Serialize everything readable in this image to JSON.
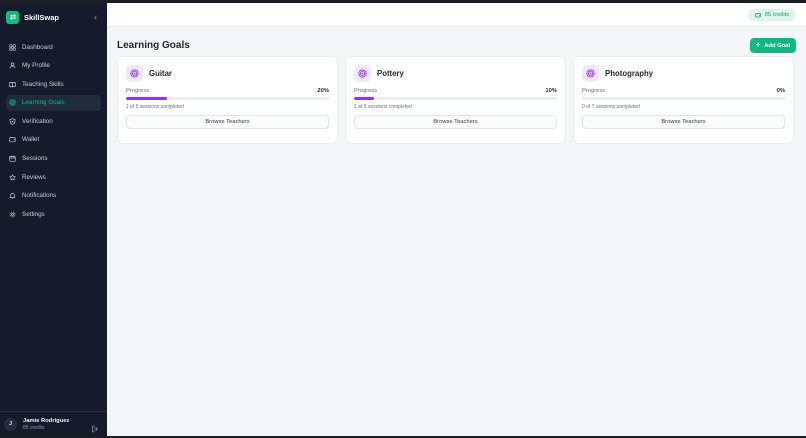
{
  "brand": {
    "name": "SkillSwap"
  },
  "sidebar": {
    "items": [
      {
        "label": "Dashboard",
        "icon": "grid-icon",
        "active": false
      },
      {
        "label": "My Profile",
        "icon": "user-icon",
        "active": false
      },
      {
        "label": "Teaching Skills",
        "icon": "book-icon",
        "active": false
      },
      {
        "label": "Learning Goals",
        "icon": "target-icon",
        "active": true
      },
      {
        "label": "Verification",
        "icon": "shield-icon",
        "active": false
      },
      {
        "label": "Wallet",
        "icon": "wallet-icon",
        "active": false
      },
      {
        "label": "Sessions",
        "icon": "calendar-icon",
        "active": false
      },
      {
        "label": "Reviews",
        "icon": "star-icon",
        "active": false
      },
      {
        "label": "Notifications",
        "icon": "bell-icon",
        "active": false
      },
      {
        "label": "Settings",
        "icon": "gear-icon",
        "active": false
      }
    ]
  },
  "user": {
    "initial": "J",
    "name": "Jamie Rodriguez",
    "credits": "85 credits"
  },
  "header": {
    "credits_badge": "85 credits"
  },
  "page": {
    "title": "Learning Goals",
    "add_button": "Add Goal"
  },
  "goals": [
    {
      "name": "Guitar",
      "progress_label": "Progress",
      "percent_text": "20%",
      "progress": 0.2,
      "sessions": "1 of 5 sessions completed",
      "button": "Browse Teachers"
    },
    {
      "name": "Pottery",
      "progress_label": "Progress",
      "percent_text": "10%",
      "progress": 0.1,
      "sessions": "1 of 8 sessions completed",
      "button": "Browse Teachers"
    },
    {
      "name": "Photography",
      "progress_label": "Progress",
      "percent_text": "0%",
      "progress": 0.0,
      "sessions": "0 of 7 sessions completed",
      "button": "Browse Teachers"
    }
  ],
  "colors": {
    "accent": "#10b981",
    "sidebar_bg": "#151b2b",
    "progress_fill": "#9333ea",
    "goal_icon_bg": "#efe7fb"
  }
}
